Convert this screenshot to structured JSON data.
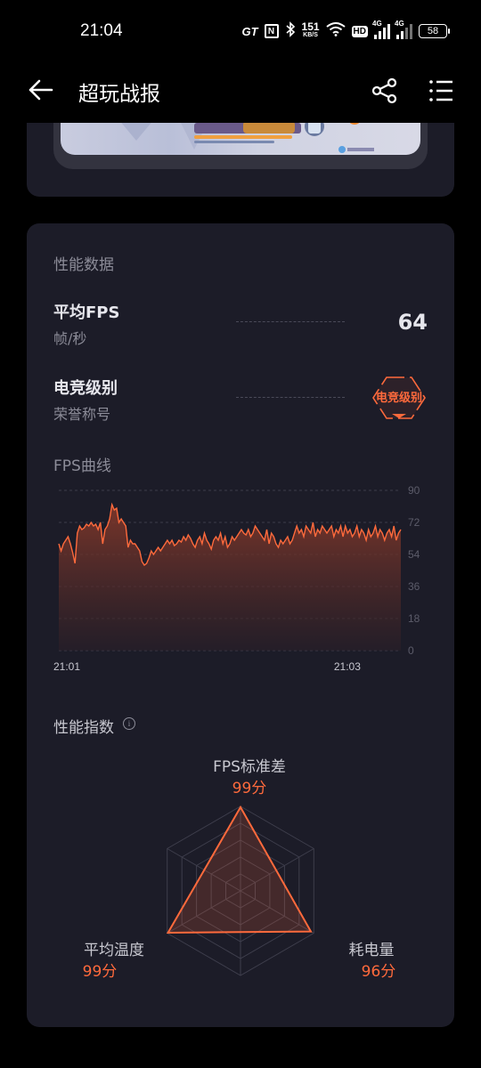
{
  "status_bar": {
    "time": "21:04",
    "gt": "GT",
    "nfc": "N",
    "speed_value": "151",
    "speed_unit": "KB/S",
    "hd": "HD",
    "network_1": "4G",
    "network_2": "4G",
    "battery": "58"
  },
  "app_bar": {
    "title": "超玩战报",
    "back_icon": "arrow-left-icon",
    "share_icon": "share-icon",
    "menu_icon": "list-menu-icon"
  },
  "performance": {
    "section_title": "性能数据",
    "avg_fps_label": "平均FPS",
    "avg_fps_unit": "帧/秒",
    "avg_fps_value": "64",
    "esports_label": "电竞级别",
    "esports_sub": "荣誉称号",
    "esports_badge": "电竞级别"
  },
  "fps_chart_title": "FPS曲线",
  "chart_data": {
    "type": "area",
    "title": "FPS曲线",
    "x_tick_labels": [
      "21:01",
      "21:03"
    ],
    "y_ticks": [
      0,
      18,
      36,
      54,
      72,
      90
    ],
    "ylim": [
      0,
      90
    ],
    "grid": true,
    "series": [
      {
        "values": [
          60,
          56,
          60,
          62,
          64,
          60,
          55,
          49,
          66,
          70,
          68,
          69,
          71,
          70,
          72,
          70,
          71,
          68,
          72,
          60,
          68,
          70,
          74,
          82,
          79,
          80,
          72,
          74,
          72,
          70,
          58,
          62,
          60,
          60,
          58,
          56,
          50,
          48,
          49,
          52,
          56,
          54,
          56,
          58,
          56,
          58,
          60,
          62,
          60,
          62,
          59,
          60,
          62,
          61,
          64,
          62,
          65,
          63,
          60,
          58,
          62,
          64,
          60,
          66,
          62,
          60,
          57,
          62,
          64,
          62,
          66,
          60,
          64,
          58,
          60,
          64,
          62,
          64,
          66,
          68,
          66,
          65,
          68,
          64,
          66,
          70,
          68,
          66,
          64,
          62,
          68,
          60,
          66,
          64,
          60,
          58,
          62,
          60,
          62,
          64,
          60,
          62,
          66,
          70,
          66,
          68,
          64,
          70,
          68,
          66,
          72,
          64,
          68,
          66,
          70,
          68,
          66,
          68,
          70,
          64,
          68,
          66,
          70,
          64,
          70,
          66,
          68,
          64,
          66,
          70,
          64,
          68,
          66,
          62,
          68,
          64,
          66,
          70,
          64,
          68,
          66,
          62,
          66,
          68,
          64,
          70,
          62,
          66,
          68
        ]
      }
    ]
  },
  "index_section": {
    "title": "性能指数",
    "info_icon": "info-icon",
    "info_glyph": "i"
  },
  "radar": {
    "type": "radar",
    "max": 100,
    "axes": [
      {
        "name": "FPS标准差",
        "score": "99分",
        "value": 99
      },
      {
        "name": "耗电量",
        "score": "96分",
        "value": 96
      },
      {
        "name": "平均温度",
        "score": "99分",
        "value": 99
      }
    ]
  },
  "colors": {
    "accent": "#ff6a3c",
    "card_bg": "#1c1c28",
    "page_bg": "#000000"
  }
}
